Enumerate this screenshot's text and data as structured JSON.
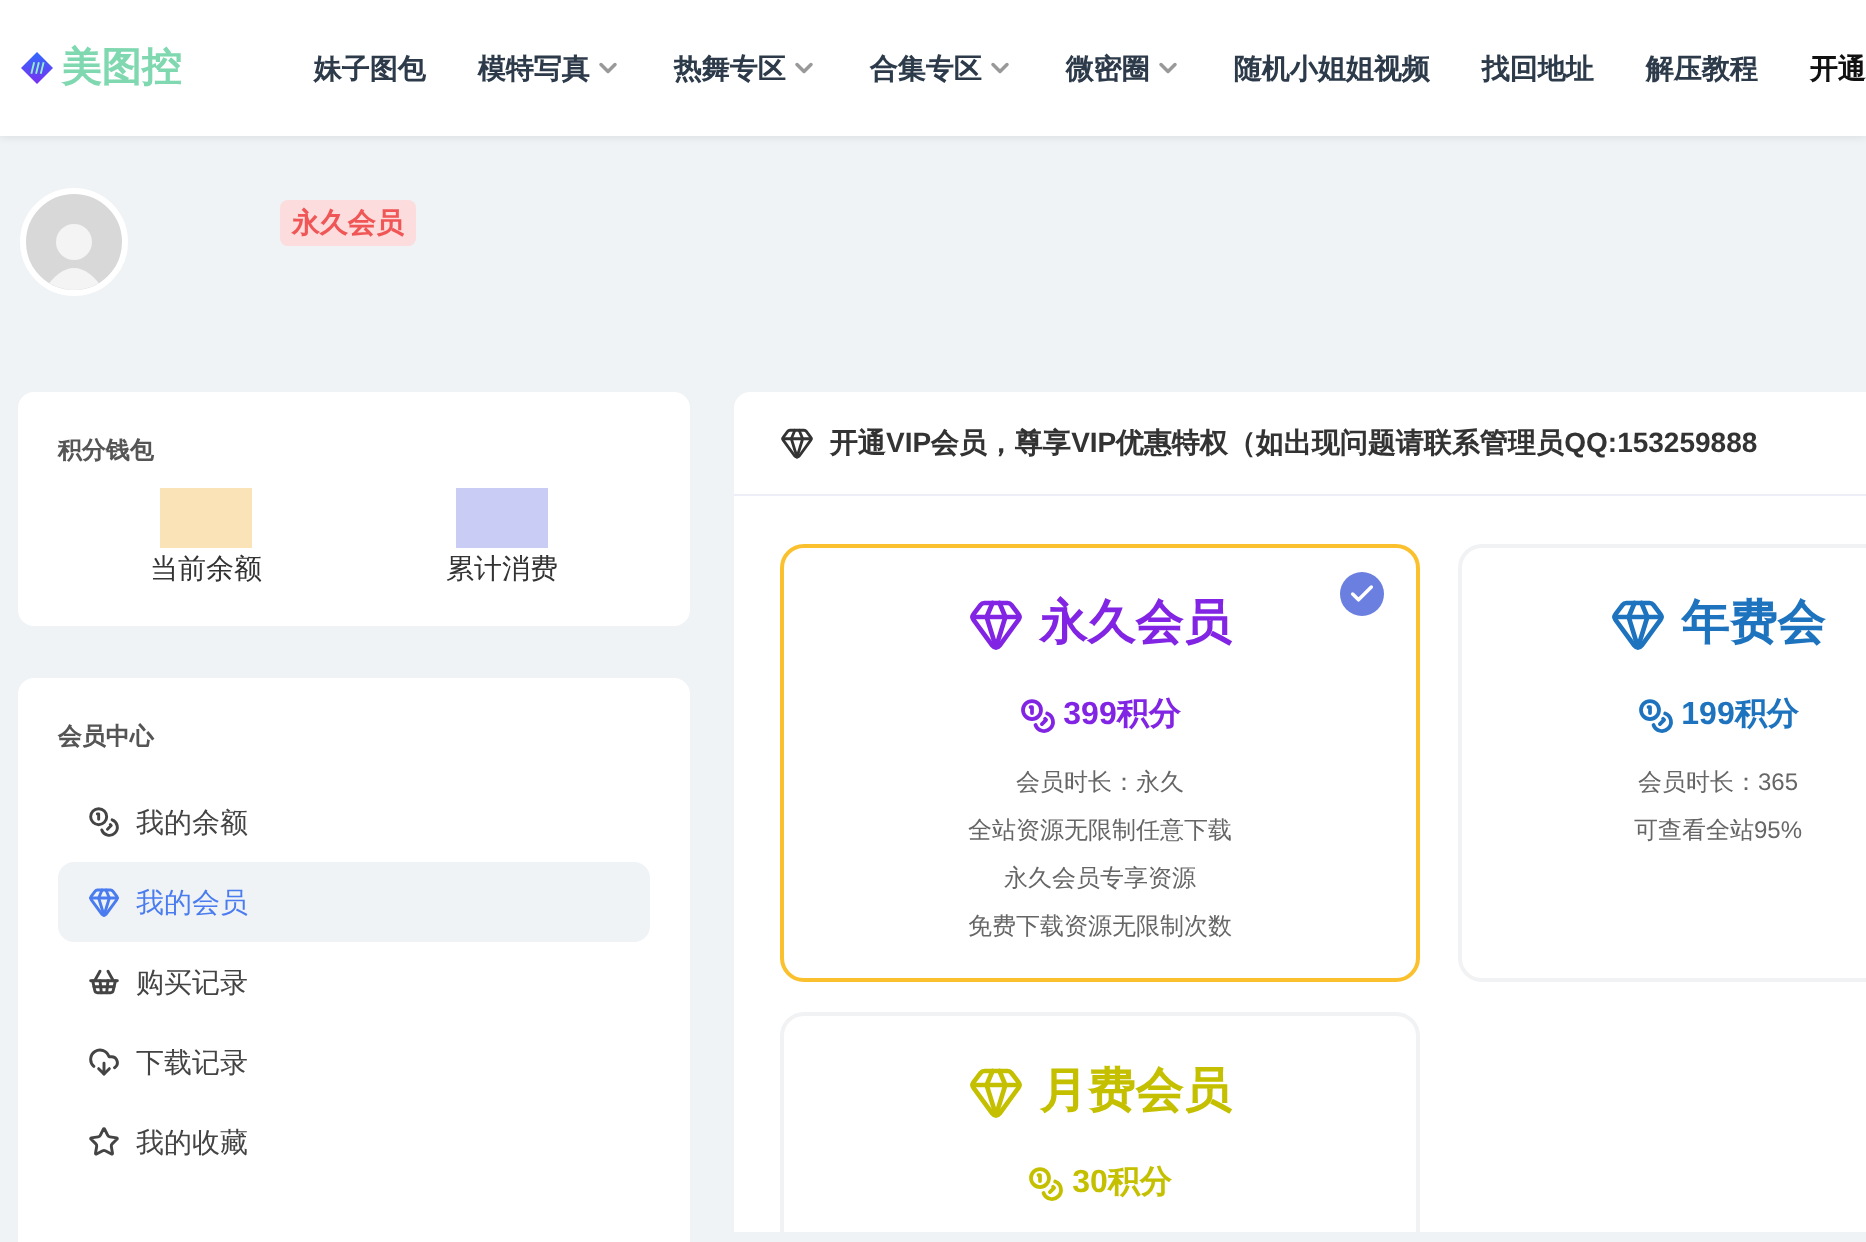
{
  "header": {
    "logo_text": "美图控",
    "nav": [
      {
        "label": "妹子图包",
        "has_dropdown": false
      },
      {
        "label": "模特写真",
        "has_dropdown": true
      },
      {
        "label": "热舞专区",
        "has_dropdown": true
      },
      {
        "label": "合集专区",
        "has_dropdown": true
      },
      {
        "label": "微密圈",
        "has_dropdown": true
      },
      {
        "label": "随机小姐姐视频",
        "has_dropdown": false
      },
      {
        "label": "找回地址",
        "has_dropdown": false
      },
      {
        "label": "解压教程",
        "has_dropdown": false
      },
      {
        "label": "开通",
        "has_dropdown": false
      }
    ]
  },
  "profile": {
    "badge": "永久会员"
  },
  "wallet": {
    "title": "积分钱包",
    "stats": [
      {
        "label": "当前余额",
        "color": "#fbe3b8"
      },
      {
        "label": "累计消费",
        "color": "#c9ccf5"
      }
    ]
  },
  "member_center": {
    "title": "会员中心",
    "items": [
      {
        "label": "我的余额",
        "selected": false
      },
      {
        "label": "我的会员",
        "selected": true
      },
      {
        "label": "购买记录",
        "selected": false
      },
      {
        "label": "下载记录",
        "selected": false
      },
      {
        "label": "我的收藏",
        "selected": false
      }
    ]
  },
  "vip_panel": {
    "heading": "开通VIP会员，尊享VIP优惠特权（如出现问题请联系管理员QQ:153259888",
    "plans": [
      {
        "name": "永久会员",
        "price": "399积分",
        "color": "#8224e3",
        "selected": true,
        "features": [
          "会员时长：永久",
          "全站资源无限制任意下载",
          "永久会员专享资源",
          "免费下载资源无限制次数"
        ]
      },
      {
        "name": "年费会",
        "price": "199积分",
        "color": "#1e73be",
        "selected": false,
        "features": [
          "会员时长：365",
          "可查看全站95%"
        ]
      },
      {
        "name": "月费会员",
        "price": "30积分",
        "color": "#c4c000",
        "selected": false
      }
    ]
  }
}
